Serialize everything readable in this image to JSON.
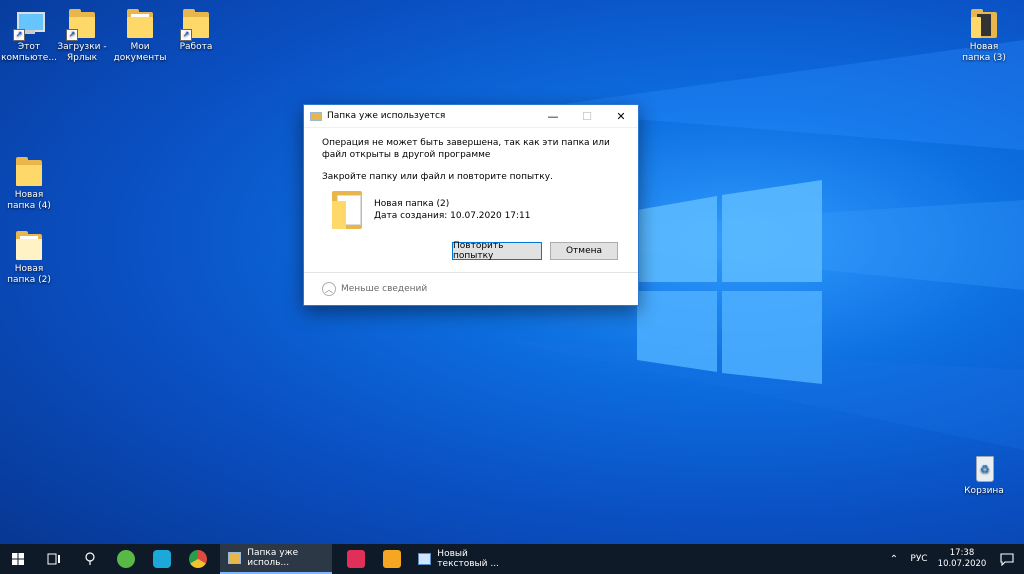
{
  "desktop": {
    "icons": [
      {
        "label": "Этот компьюте..."
      },
      {
        "label": "Загрузки - Ярлык"
      },
      {
        "label": "Мои документы"
      },
      {
        "label": "Работа"
      },
      {
        "label": "Новая папка (4)"
      },
      {
        "label": "Новая папка (2)"
      },
      {
        "label": "Новая папка (3)"
      },
      {
        "label": "Корзина"
      }
    ]
  },
  "dialog": {
    "title": "Папка уже используется",
    "message": "Операция не может быть завершена, так как эти папка или файл открыты в другой программе",
    "instruction": "Закройте папку или файл и повторите попытку.",
    "file_name": "Новая папка (2)",
    "file_date": "Дата создания: 10.07.2020 17:11",
    "retry_label": "Повторить попытку",
    "cancel_label": "Отмена",
    "details_label": "Меньше сведений",
    "minimize_glyph": "—",
    "maximize_glyph": "☐",
    "close_glyph": "✕"
  },
  "taskbar": {
    "start_icon": "windows-logo-icon",
    "apps": [
      {
        "icon": "task-view-icon"
      },
      {
        "icon": "cortana-icon"
      },
      {
        "icon": "utorrent-icon",
        "color": "#58b947"
      },
      {
        "icon": "app-icon",
        "color": "#1ca8d8"
      },
      {
        "icon": "chrome-icon",
        "color": "#dd4b3e"
      }
    ],
    "window_active": "Папка уже исполь...",
    "app_extra1": {
      "icon": "pinwheel-icon",
      "color": "#e0305a"
    },
    "app_extra2": {
      "icon": "media-player-icon",
      "color": "#f5a623"
    },
    "window_notepad": "Новый текстовый ...",
    "language": "РУС",
    "time": "17:38",
    "date": "10.07.2020"
  }
}
